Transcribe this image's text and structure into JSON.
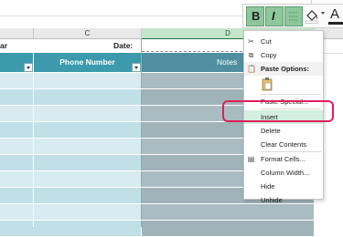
{
  "column_headers": {
    "c": "C",
    "d": "D"
  },
  "row1": {
    "cell_ar": "ar",
    "date_label": "Date:"
  },
  "table_headers": {
    "phone": "Phone Number",
    "notes": "Notes"
  },
  "toolbar": {
    "bold": "B",
    "italic": "I",
    "font_color": "A"
  },
  "context_menu": {
    "cut": "Cut",
    "copy": "Copy",
    "paste_options": "Paste Options:",
    "paste_special": "Paste Special...",
    "insert": "Insert",
    "delete": "Delete",
    "clear_contents": "Clear Contents",
    "format_cells": "Format Cells...",
    "column_width": "Column Width...",
    "hide": "Hide",
    "unhide": "Unhide"
  },
  "colors": {
    "header_teal": "#3d9aad",
    "notes_header": "#4f8fa0",
    "band_light": "#d7ebf0",
    "band_dark": "#c1dfe7",
    "notes_light": "#a9bcc1",
    "notes_dark": "#9fb3b8",
    "highlight": "#e01e5a",
    "accent_green": "#217346"
  }
}
